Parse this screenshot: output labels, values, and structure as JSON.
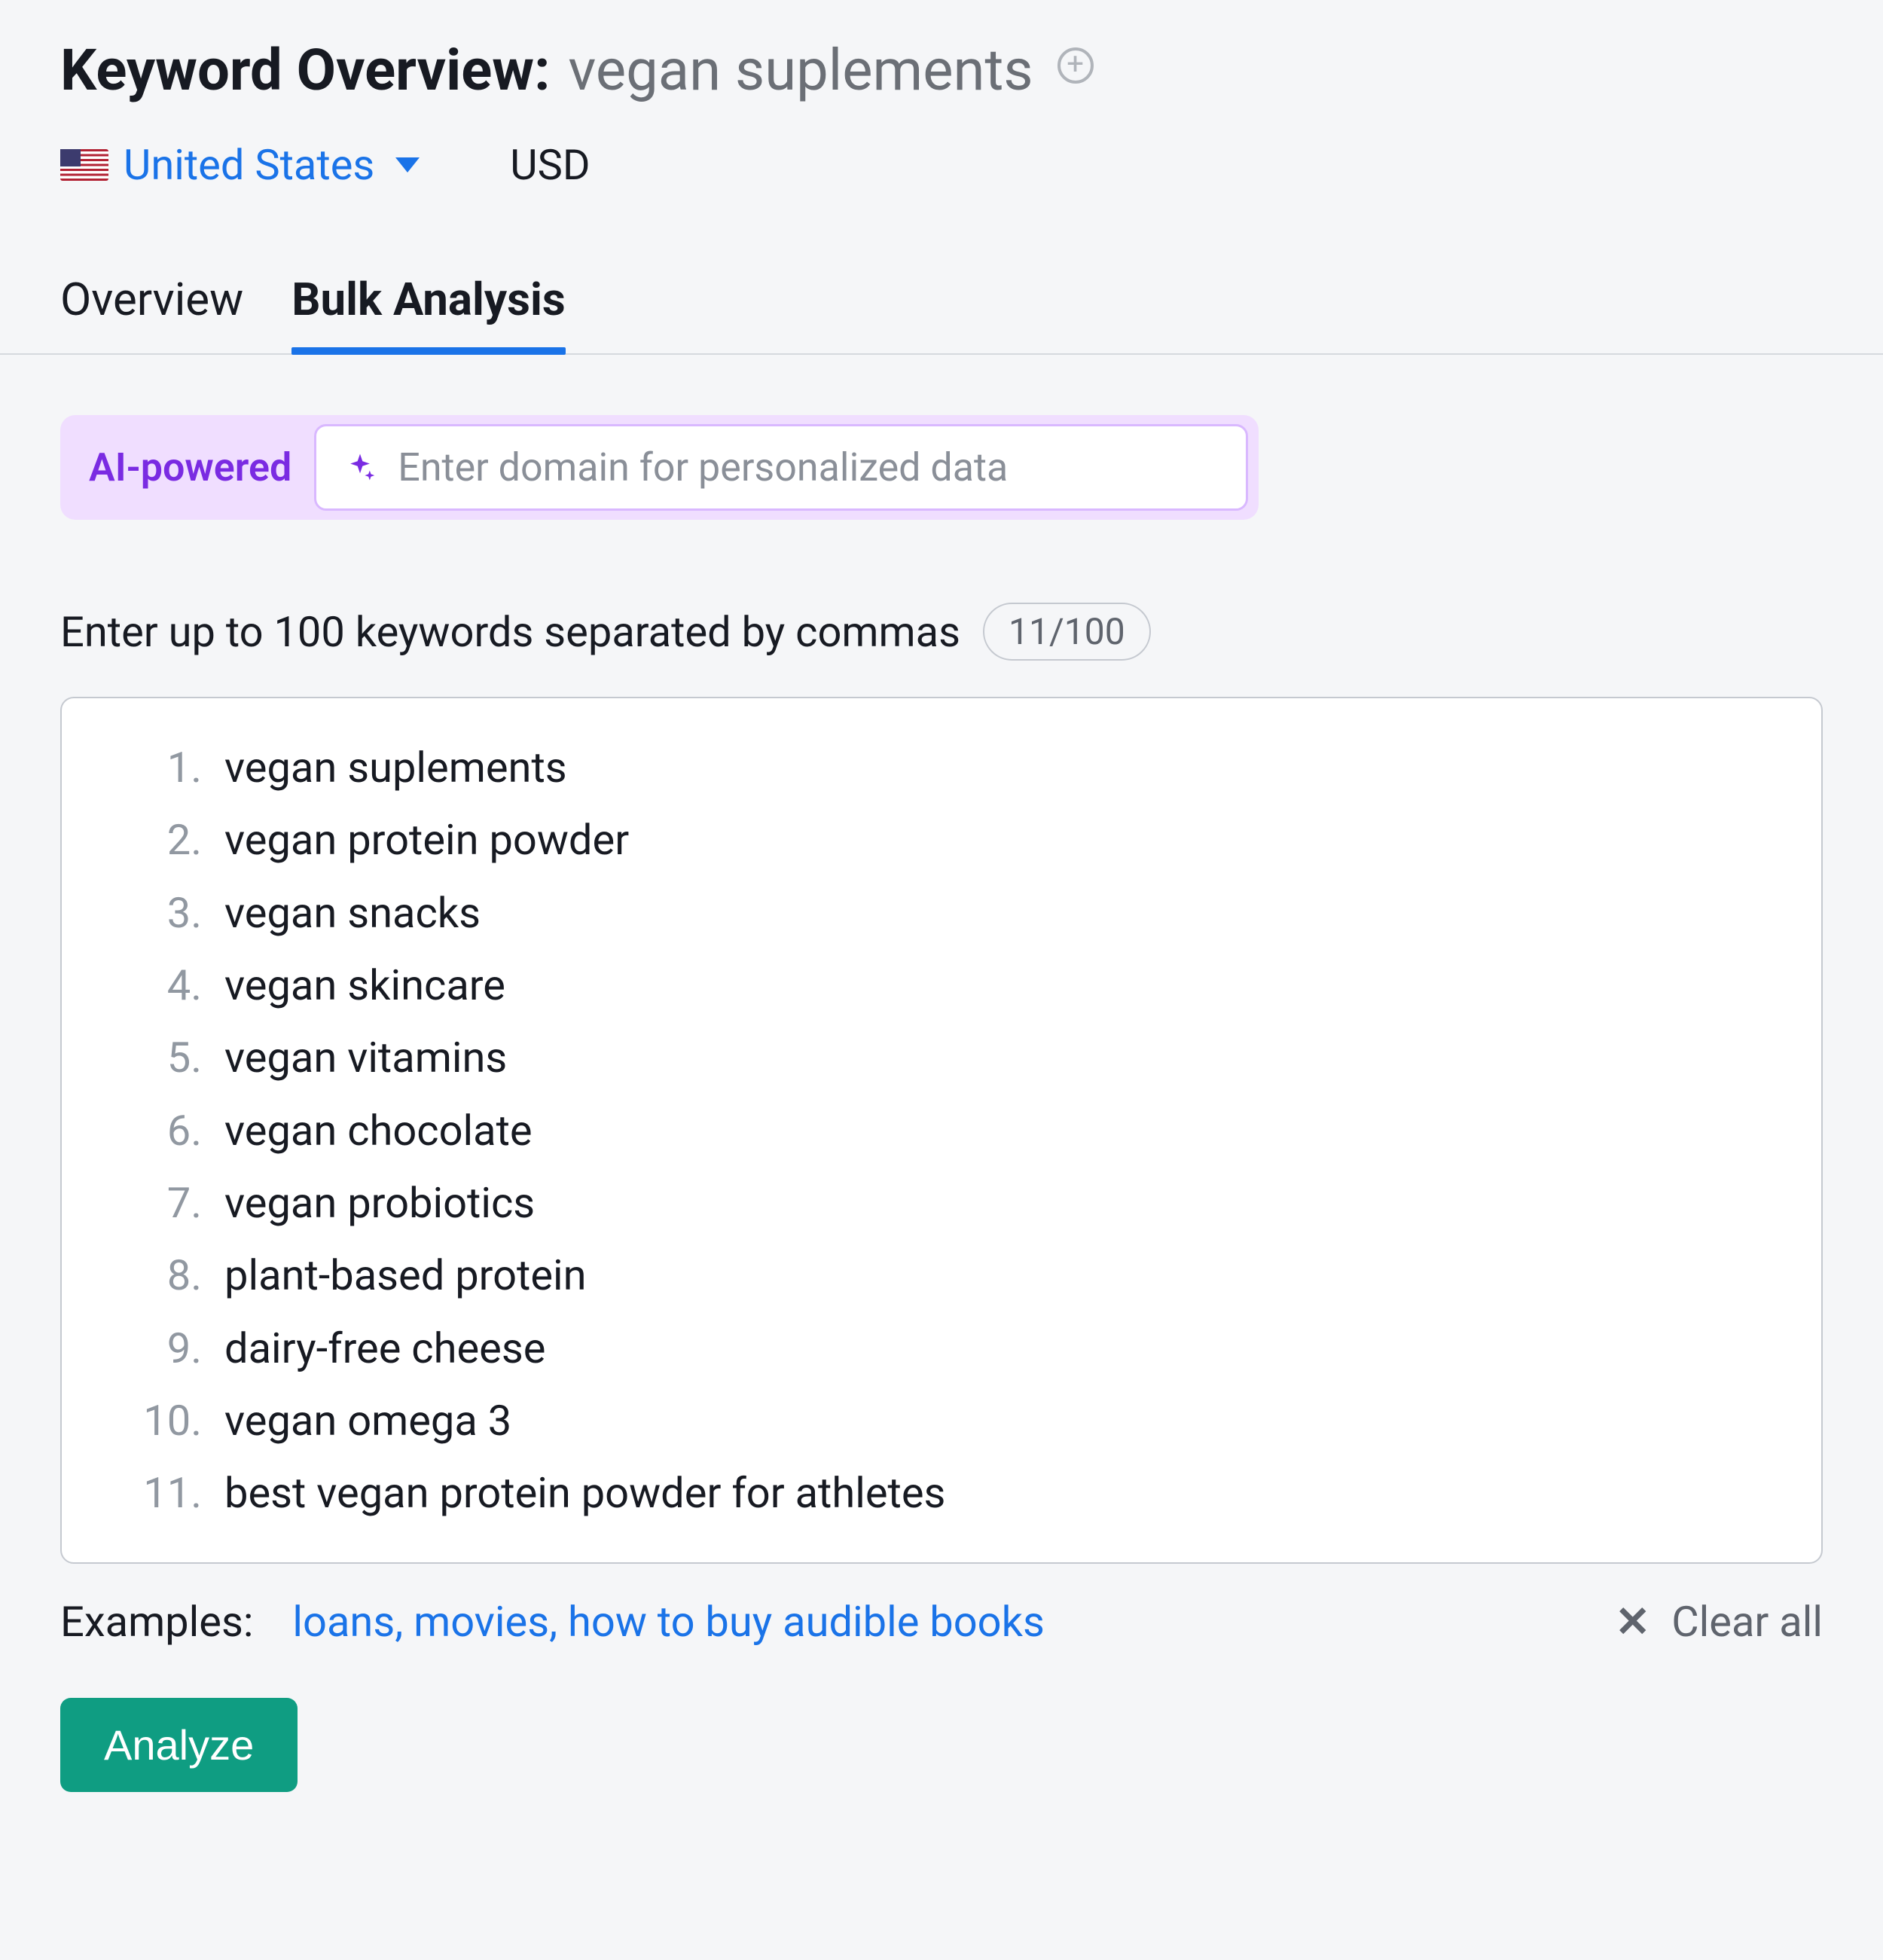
{
  "header": {
    "title_label": "Keyword Overview:",
    "keyword": "vegan suplements"
  },
  "meta": {
    "country": "United States",
    "currency": "USD"
  },
  "tabs": {
    "overview": "Overview",
    "bulk": "Bulk Analysis"
  },
  "ai": {
    "label": "AI-powered",
    "placeholder": "Enter domain for personalized data"
  },
  "prompt": {
    "text": "Enter up to 100 keywords separated by commas",
    "counter": "11/100"
  },
  "keywords": [
    "vegan suplements",
    "vegan protein powder",
    "vegan snacks",
    "vegan skincare",
    "vegan vitamins",
    "vegan chocolate",
    "vegan probiotics",
    "plant-based protein",
    "dairy-free cheese",
    "vegan omega 3",
    "best vegan protein powder for athletes"
  ],
  "examples": {
    "label": "Examples:",
    "link": "loans, movies, how to buy audible books"
  },
  "clear_all": "Clear all",
  "analyze": "Analyze"
}
